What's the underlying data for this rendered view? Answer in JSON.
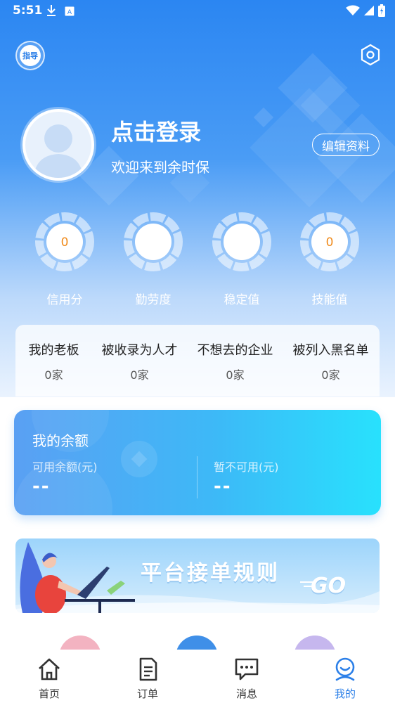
{
  "status_bar": {
    "time": "5:51"
  },
  "header": {
    "guide_label": "指导"
  },
  "profile": {
    "login_title": "点击登录",
    "welcome": "欢迎来到余时保",
    "edit_button": "编辑资料"
  },
  "stats": [
    {
      "label": "信用分",
      "value": "0"
    },
    {
      "label": "勤劳度",
      "value": ""
    },
    {
      "label": "稳定值",
      "value": ""
    },
    {
      "label": "技能值",
      "value": "0"
    }
  ],
  "favorites": [
    {
      "title": "我的老板",
      "count": "0家"
    },
    {
      "title": "被收录为人才",
      "count": "0家"
    },
    {
      "title": "不想去的企业",
      "count": "0家"
    },
    {
      "title": "被列入黑名单",
      "count": "0家"
    }
  ],
  "balance": {
    "title": "我的余额",
    "available_label": "可用余额(元)",
    "available_value": "--",
    "unavailable_label": "暂不可用(元)",
    "unavailable_value": "--"
  },
  "banner": {
    "title": "平台接单规则",
    "go_text": "GO"
  },
  "tabbar": [
    {
      "label": "首页",
      "icon": "home-icon"
    },
    {
      "label": "订单",
      "icon": "order-icon"
    },
    {
      "label": "消息",
      "icon": "message-icon"
    },
    {
      "label": "我的",
      "icon": "profile-icon",
      "active": true
    }
  ],
  "colors": {
    "accent": "#2b7fe8",
    "stat_value": "#f08a1a"
  }
}
